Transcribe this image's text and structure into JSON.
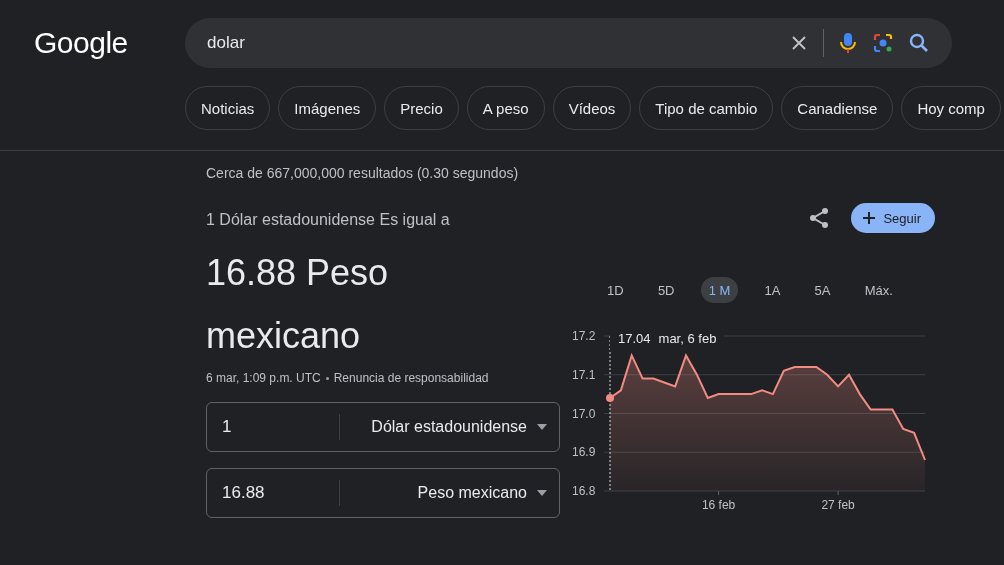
{
  "logo": "Google",
  "search": {
    "value": "dolar"
  },
  "chips": [
    {
      "label": "Noticias"
    },
    {
      "label": "Imágenes"
    },
    {
      "label": "Precio"
    },
    {
      "label": "A peso"
    },
    {
      "label": "Vídeos"
    },
    {
      "label": "Tipo de cambio"
    },
    {
      "label": "Canadiense"
    },
    {
      "label": "Hoy comp"
    }
  ],
  "result_stats": "Cerca de 667,000,000 resultados (0.30 segundos)",
  "converter": {
    "equals_line": "1 Dólar estadounidense Es igual a",
    "result": "16.88 Peso mexicano",
    "timestamp": "6 mar, 1:09 p.m. UTC",
    "disclaimer": "Renuncia de responsabilidad",
    "follow_button": "Seguir",
    "rows": [
      {
        "amount": "1",
        "currency": "Dólar estadounidense"
      },
      {
        "amount": "16.88",
        "currency": "Peso mexicano"
      }
    ]
  },
  "ranges": [
    {
      "label": "1D",
      "selected": false
    },
    {
      "label": "5D",
      "selected": false
    },
    {
      "label": "1 M",
      "selected": true
    },
    {
      "label": "1A",
      "selected": false
    },
    {
      "label": "5A",
      "selected": false
    },
    {
      "label": "Máx.",
      "selected": false
    }
  ],
  "chart": {
    "tooltip": {
      "value": "17.04",
      "date": "mar, 6 feb"
    },
    "chart_data": {
      "type": "area",
      "categories": [
        null,
        null,
        null,
        null,
        null,
        null,
        null,
        null,
        null,
        null,
        "16 feb",
        null,
        null,
        null,
        null,
        null,
        null,
        null,
        null,
        null,
        null,
        "27 feb",
        null,
        null,
        null,
        null,
        null,
        null,
        null,
        null
      ],
      "series": [
        {
          "color": "#f28b82",
          "values": [
            17.04,
            17.06,
            17.15,
            17.09,
            17.09,
            17.08,
            17.07,
            17.15,
            17.1,
            17.04,
            17.05,
            17.05,
            17.05,
            17.05,
            17.06,
            17.05,
            17.11,
            17.12,
            17.12,
            17.12,
            17.1,
            17.07,
            17.1,
            17.05,
            17.01,
            17.01,
            17.01,
            16.96,
            16.95,
            16.88
          ]
        }
      ],
      "ylim": [
        16.8,
        17.2
      ],
      "grid": true,
      "yticks": [
        {
          "value": 16.8,
          "label": "16.8"
        },
        {
          "value": 16.9,
          "label": "16.9"
        },
        {
          "value": 17.0,
          "label": "17.0"
        },
        {
          "value": 17.1,
          "label": "17.1"
        },
        {
          "value": 17.2,
          "label": "17.2"
        }
      ]
    }
  }
}
